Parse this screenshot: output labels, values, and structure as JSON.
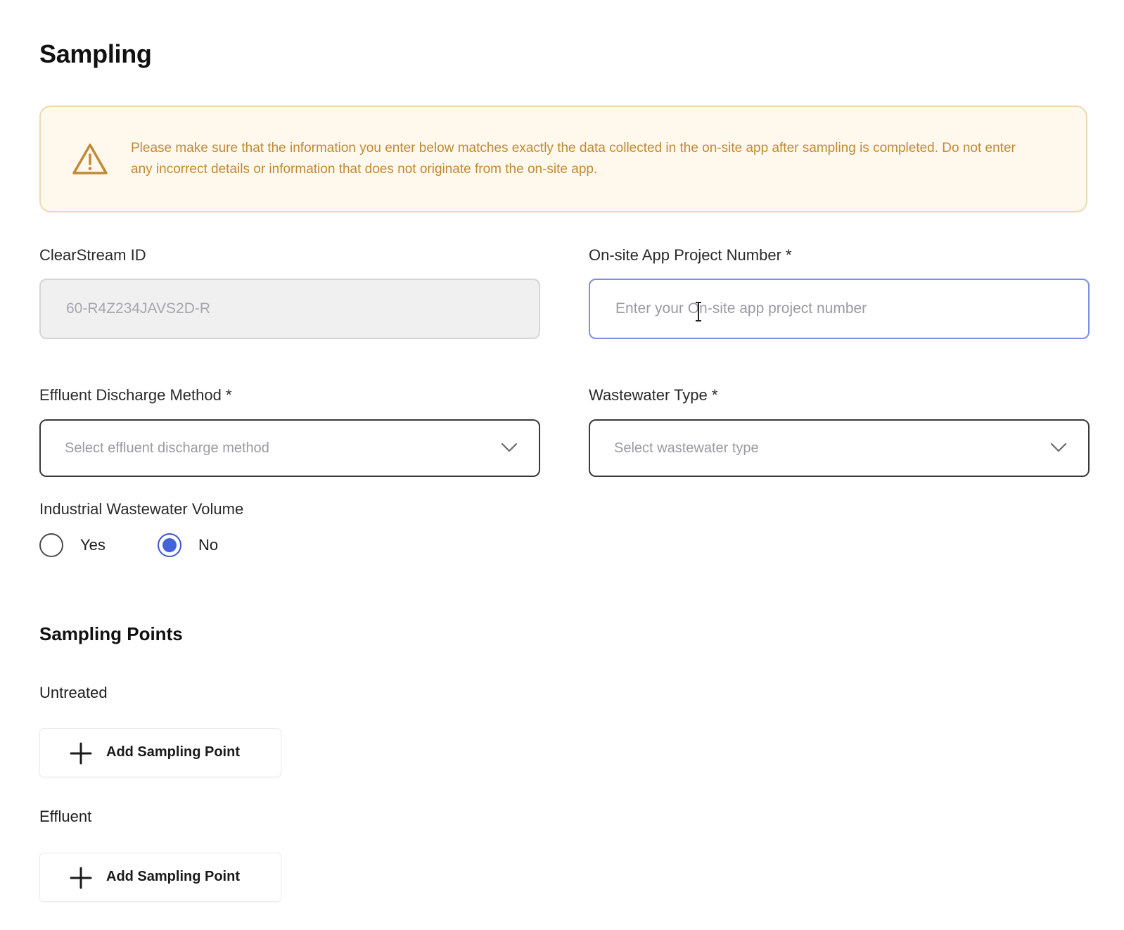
{
  "page": {
    "title": "Sampling"
  },
  "notice": {
    "icon": "warning-triangle-icon",
    "text": "Please make sure that the information you enter below matches exactly the data collected in the on-site app after sampling is completed. Do not enter any incorrect details or information that does not originate from the on-site app.",
    "colors": {
      "background": "#fff8ec",
      "border": "#ecd9b3",
      "text": "#c08a36"
    }
  },
  "form": {
    "clearstream_id": {
      "label": "ClearStream ID",
      "value": "60-R4Z234JAVS2D-R",
      "disabled": true
    },
    "project_number": {
      "label": "On-site App Project Number *",
      "placeholder": "Enter your On-site app project number",
      "focused": true
    },
    "discharge_method": {
      "label": "Effluent Discharge Method *",
      "placeholder": "Select effluent discharge method",
      "icon": "chevron-down-icon"
    },
    "wastewater_type": {
      "label": "Wastewater Type *",
      "placeholder": "Select wastewater type",
      "icon": "chevron-down-icon"
    },
    "industrial_volume": {
      "label": "Industrial Wastewater Volume",
      "options": [
        "Yes",
        "No"
      ],
      "selected": "No",
      "accent_color": "#4363d8"
    }
  },
  "sampling_points": {
    "title": "Sampling Points",
    "groups": [
      {
        "label": "Untreated",
        "button_label": "Add Sampling Point",
        "icon": "plus-icon"
      },
      {
        "label": "Effluent",
        "button_label": "Add Sampling Point",
        "icon": "plus-icon"
      }
    ]
  }
}
